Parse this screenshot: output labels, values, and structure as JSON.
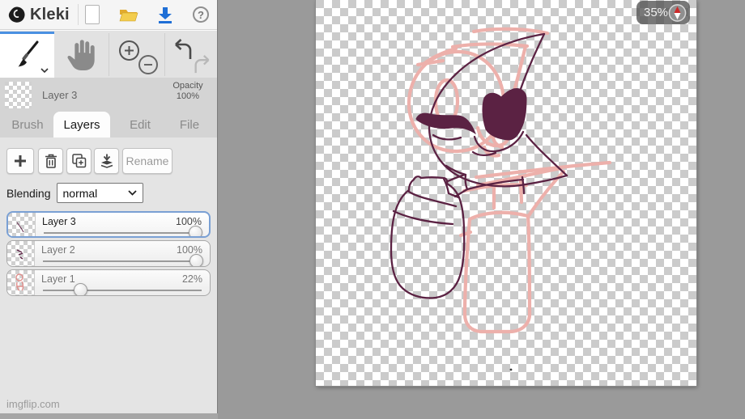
{
  "app": {
    "name": "Kleki",
    "watermark": "imgflip.com"
  },
  "topbar": {
    "help_glyph": "?"
  },
  "layer_preview": {
    "layer_name": "Layer 3",
    "opacity_label": "Opacity",
    "opacity_value": "100%"
  },
  "tabs": {
    "brush": "Brush",
    "layers": "Layers",
    "edit": "Edit",
    "file": "File",
    "active": "Layers"
  },
  "layers_panel": {
    "rename_label": "Rename",
    "blending_label": "Blending",
    "blending_value": "normal",
    "layers": [
      {
        "name": "Layer 3",
        "opacity_label": "100%",
        "opacity_pct": 100,
        "selected": true
      },
      {
        "name": "Layer 2",
        "opacity_label": "100%",
        "opacity_pct": 100,
        "selected": false
      },
      {
        "name": "Layer 1",
        "opacity_label": "22%",
        "opacity_pct": 22,
        "selected": false
      }
    ]
  },
  "canvas": {
    "zoom_value": "35%"
  },
  "colors": {
    "ink": "#5b2243",
    "sketch": "#edb0ab",
    "accent_blue": "#4a90e2",
    "selected_border": "#7aa0d4",
    "workspace_gray": "#9a9a9a",
    "checker_light": "#ffffff",
    "checker_dark": "#cbcbcb",
    "download_blue": "#1f6fd6",
    "folder_yellow": "#f3cd4e",
    "compass_red": "#cc2a2a"
  }
}
